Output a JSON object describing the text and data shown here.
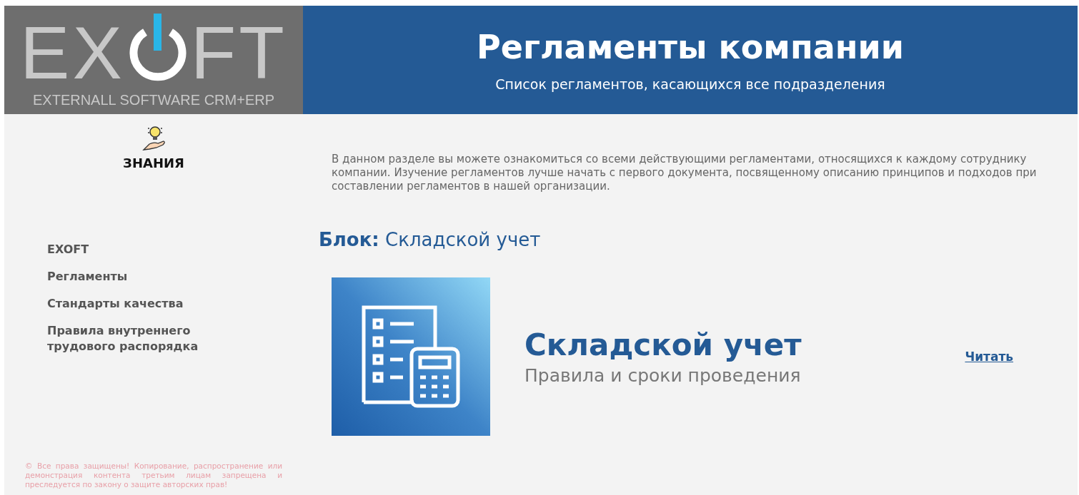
{
  "logo": {
    "left": "EX",
    "right": "FT",
    "tagline": "EXTERNALL SOFTWARE CRM+ERP"
  },
  "header": {
    "title": "Регламенты компании",
    "subtitle": "Список регламентов, касающихся все подразделения"
  },
  "section": {
    "label": "ЗНАНИЯ"
  },
  "sidebar": {
    "items": [
      {
        "label": "EXOFT"
      },
      {
        "label": "Регламенты"
      },
      {
        "label": "Стандарты качества"
      },
      {
        "label": "Правила внутреннего трудового распорядка"
      }
    ]
  },
  "copyright": "© Все права защищены! Копирование, распространение или демонстрация контента третьим лицам запрещена и преследуется по закону о защите авторских прав!",
  "intro": "В данном разделе вы можете ознакомиться со всеми действующими регламентами, относящихся к каждому сотруднику компании. Изучение регламентов лучше начать с первого документа, посвященному описанию принципов и подходов при составлении регламентов в нашей организации.",
  "block": {
    "prefix": "Блок:",
    "name": "Складской учет"
  },
  "documents": [
    {
      "title": "Складской учет",
      "subtitle": "Правила и сроки проведения",
      "link": "Читать"
    }
  ]
}
